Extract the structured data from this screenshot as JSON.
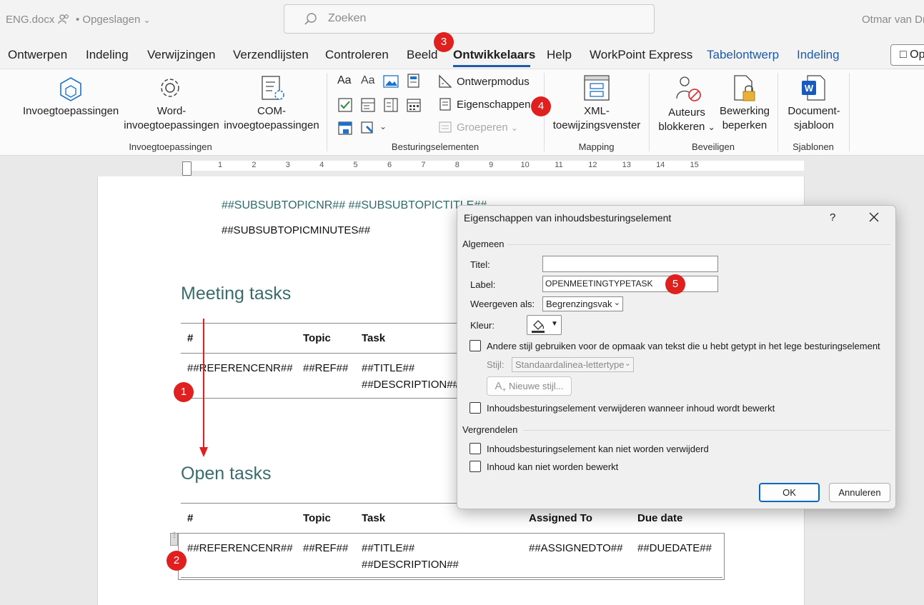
{
  "titlebar": {
    "doc_name": "ENG.docx",
    "save_state": "• Opgeslagen",
    "search_placeholder": "Zoeken",
    "user_name": "Otmar van Dr"
  },
  "tabs": [
    "Ontwerpen",
    "Indeling",
    "Verwijzingen",
    "Verzendlijsten",
    "Controleren",
    "Beeld",
    "Ontwikkelaars",
    "Help",
    "WorkPoint Express",
    "Tabelontwerp",
    "Indeling"
  ],
  "active_tab": "Ontwikkelaars",
  "open_button": "Op",
  "ribbon": {
    "invoeg": {
      "group": "Invoegtoepassingen",
      "btn1": "Invoegtoepassingen",
      "btn2_l1": "Word-",
      "btn2_l2": "invoegtoepassingen",
      "btn3_l1": "COM-",
      "btn3_l2": "invoegtoepassingen"
    },
    "besturing": {
      "group": "Besturingselementen",
      "ontwerpmodus": "Ontwerpmodus",
      "eigenschappen": "Eigenschappen",
      "groeperen": "Groeperen"
    },
    "mapping": {
      "group": "Mapping",
      "xml_l1": "XML-",
      "xml_l2": "toewijzingsvenster"
    },
    "beveiligen": {
      "group": "Beveiligen",
      "auteurs_l1": "Auteurs",
      "auteurs_l2": "blokkeren",
      "bewerking_l1": "Bewerking",
      "bewerking_l2": "beperken"
    },
    "sjablonen": {
      "group": "Sjablonen",
      "doc_l1": "Document-",
      "doc_l2": "sjabloon"
    }
  },
  "ruler": [
    "1",
    "2",
    "3",
    "4",
    "5",
    "6",
    "7",
    "8",
    "9",
    "10",
    "11",
    "12",
    "13",
    "14",
    "15"
  ],
  "document": {
    "subsub_title": "##SUBSUBTOPICNR## ##SUBSUBTOPICTITLE##",
    "subsub_minutes": "##SUBSUBTOPICMINUTES##",
    "meeting_heading": "Meeting tasks",
    "open_heading": "Open tasks",
    "table_headers": [
      "#",
      "Topic",
      "Task",
      "Assigned To",
      "Due date"
    ],
    "row": {
      "ref": "##REFERENCENR##",
      "topic": "##REF##",
      "title": "##TITLE##",
      "desc": "##DESCRIPTION##",
      "assigned": "##ASSIGNEDTO##",
      "due": "##DUEDATE##"
    }
  },
  "badges": [
    "1",
    "2",
    "3",
    "4",
    "5"
  ],
  "dialog": {
    "title": "Eigenschappen van inhoudsbesturingselement",
    "help": "?",
    "algemeen": "Algemeen",
    "titel_label": "Titel:",
    "titel_value": "",
    "label_label": "Label:",
    "label_value": "OPENMEETINGTYPETASK",
    "weergeven_label": "Weergeven als:",
    "weergeven_value": "Begrenzingsvak",
    "kleur_label": "Kleur:",
    "andere_stijl": "Andere stijl gebruiken voor de opmaak van tekst die u hebt getypt in het lege besturingselement",
    "stijl_label": "Stijl:",
    "stijl_value": "Standaardalinea-lettertype",
    "nieuwe_stijl": "Nieuwe stijl...",
    "verwijderen": "Inhoudsbesturingselement verwijderen wanneer inhoud wordt bewerkt",
    "vergrendelen": "Vergrendelen",
    "lock1": "Inhoudsbesturingselement kan niet worden verwijderd",
    "lock2": "Inhoud kan niet worden bewerkt",
    "ok": "OK",
    "cancel": "Annuleren"
  },
  "colors": {
    "accent": "#1e5aa8",
    "badge": "#e0201e",
    "heading": "#3a6c6c"
  }
}
